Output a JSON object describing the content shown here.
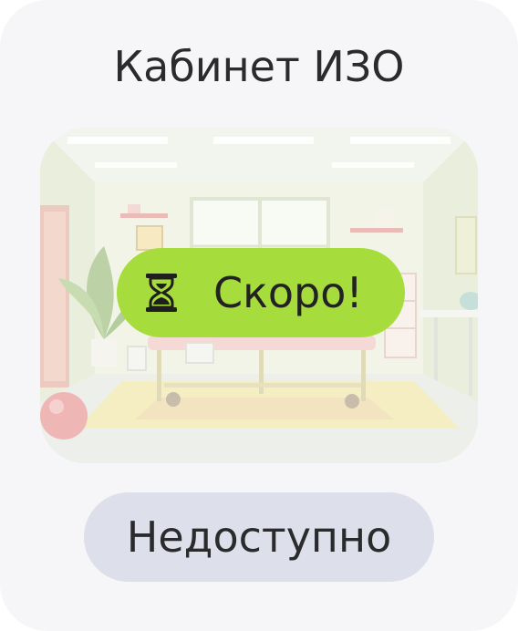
{
  "card": {
    "title": "Кабинет ИЗО",
    "image_description_icon": "classroom-illustration",
    "badge": {
      "label": "Скоро!",
      "icon": "hourglass-icon",
      "color": "#a6dd3c"
    },
    "status": {
      "label": "Недоступно",
      "color": "#dde0ea"
    }
  },
  "colors": {
    "card_background": "#f6f6f9",
    "text": "#2b2b2d"
  }
}
